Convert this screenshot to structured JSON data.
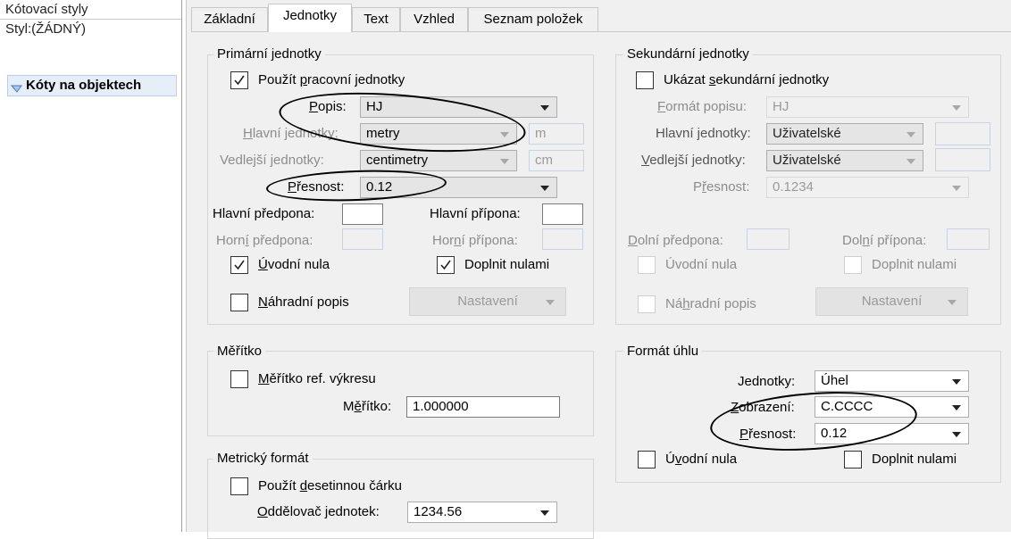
{
  "left_panel": {
    "title": "Kótovací styly",
    "style_label": "Styl:(ŽÁDNÝ)",
    "tree_item": "Kóty na objektech"
  },
  "tabs": [
    {
      "label": "Základní"
    },
    {
      "label": "Jednotky",
      "active": true
    },
    {
      "label": "Text"
    },
    {
      "label": "Vzhled"
    },
    {
      "label": "Seznam položek"
    }
  ],
  "primary": {
    "title": "Primární jednotky",
    "use_working_units": {
      "label": "Použít pracovní jednotky",
      "checked": true
    },
    "popis": {
      "label": "Popis:",
      "value": "HJ"
    },
    "main_units": {
      "label": "Hlavní jednotky:",
      "value": "metry",
      "abbr": "m"
    },
    "sub_units": {
      "label": "Vedlejší jednotky:",
      "value": "centimetry",
      "abbr": "cm"
    },
    "precision": {
      "label": "Přesnost:",
      "value": "0.12"
    },
    "main_prefix": {
      "label": "Hlavní předpona:",
      "value": ""
    },
    "main_suffix": {
      "label": "Hlavní přípona:",
      "value": ""
    },
    "upper_prefix": {
      "label": "Horní předpona:",
      "value": ""
    },
    "upper_suffix": {
      "label": "Horní přípona:",
      "value": ""
    },
    "leading_zero": {
      "label": "Úvodní nula",
      "checked": true
    },
    "trailing_zeros": {
      "label": "Doplnit nulami",
      "checked": true
    },
    "alt_text": {
      "label": "Náhradní popis",
      "checked": false
    },
    "settings_button": "Nastavení"
  },
  "secondary": {
    "title": "Sekundární jednotky",
    "show_secondary": {
      "label": "Ukázat sekundární jednotky",
      "checked": false
    },
    "format": {
      "label": "Formát popisu:",
      "value": "HJ"
    },
    "main_units": {
      "label": "Hlavní jednotky:",
      "value": "Uživatelské"
    },
    "sub_units": {
      "label": "Vedlejší jednotky:",
      "value": "Uživatelské"
    },
    "precision": {
      "label": "Přesnost:",
      "value": "0.1234"
    },
    "lower_prefix": {
      "label": "Dolní předpona:"
    },
    "lower_suffix": {
      "label": "Dolní přípona:"
    },
    "leading_zero": {
      "label": "Úvodní nula"
    },
    "trailing_zeros": {
      "label": "Doplnit nulami"
    },
    "alt_text": {
      "label": "Náhradní popis"
    },
    "settings_button": "Nastavení"
  },
  "scale": {
    "title": "Měřítko",
    "ref_scale": {
      "label": "Měřítko ref. výkresu",
      "checked": false
    },
    "scale": {
      "label": "Měřítko:",
      "value": "1.000000"
    }
  },
  "angle": {
    "title": "Formát úhlu",
    "units": {
      "label": "Jednotky:",
      "value": "Úhel"
    },
    "display": {
      "label": "Zobrazení:",
      "value": "C.CCCC"
    },
    "precision": {
      "label": "Přesnost:",
      "value": "0.12"
    },
    "leading_zero": {
      "label": "Úvodní nula",
      "checked": false
    },
    "trailing_zeros": {
      "label": "Doplnit nulami",
      "checked": false
    }
  },
  "metric": {
    "title": "Metrický formát",
    "decimal_comma": {
      "label": "Použít desetinnou čárku",
      "checked": false
    },
    "separator": {
      "label": "Oddělovač jednotek:",
      "value": "1234.56"
    }
  }
}
